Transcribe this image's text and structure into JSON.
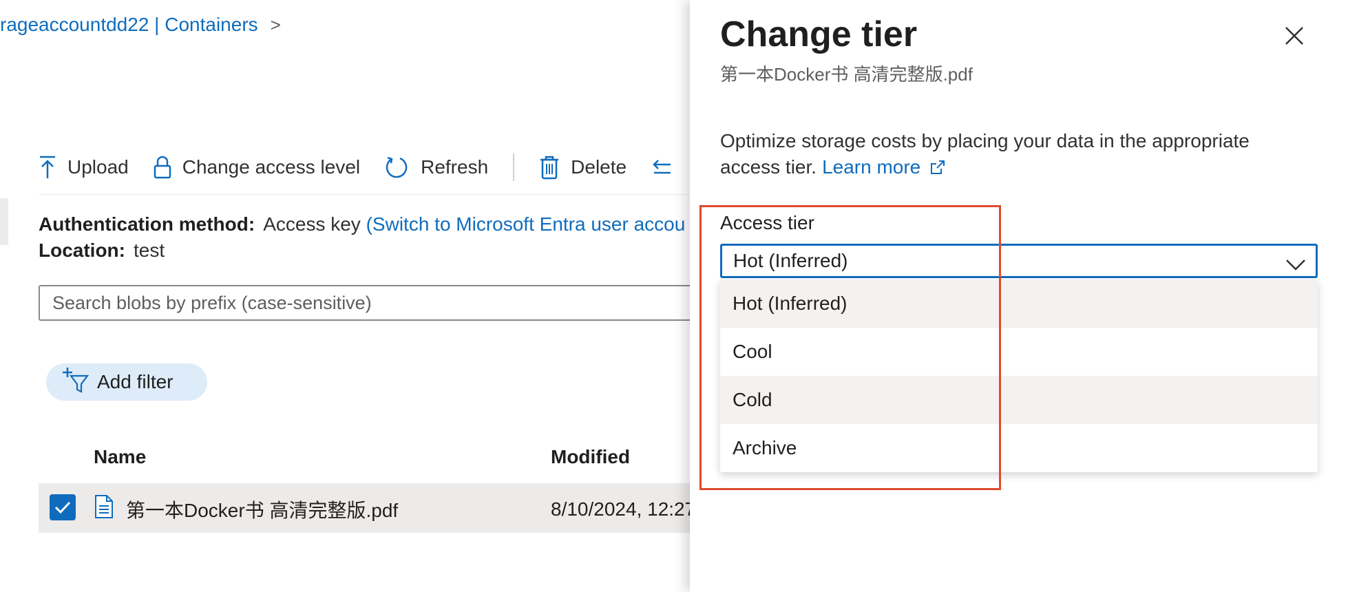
{
  "breadcrumb": {
    "text": "rageaccountdd22 | Containers",
    "chevron": ">"
  },
  "toolbar": {
    "upload": "Upload",
    "change_access": "Change access level",
    "refresh": "Refresh",
    "delete": "Delete"
  },
  "info": {
    "auth_label": "Authentication method:",
    "auth_value": "Access key",
    "auth_link": "(Switch to Microsoft Entra user accou",
    "location_label": "Location:",
    "location_value": "test"
  },
  "search": {
    "placeholder": "Search blobs by prefix (case-sensitive)"
  },
  "filter": {
    "add_label": "Add filter"
  },
  "table": {
    "columns": [
      "Name",
      "Modified"
    ],
    "rows": [
      {
        "name": "第一本Docker书 高清完整版.pdf",
        "modified": "8/10/2024, 12:27",
        "selected": true
      }
    ]
  },
  "panel": {
    "title": "Change tier",
    "subtitle": "第一本Docker书 高清完整版.pdf",
    "description": "Optimize storage costs by placing your data in the appropriate access tier.",
    "learn_more": "Learn more",
    "access_tier_label": "Access tier",
    "selected_tier": "Hot (Inferred)",
    "tier_options": [
      "Hot (Inferred)",
      "Cool",
      "Cold",
      "Archive"
    ]
  },
  "colors": {
    "accent": "#0f6cbd",
    "highlight": "#e0492d"
  }
}
